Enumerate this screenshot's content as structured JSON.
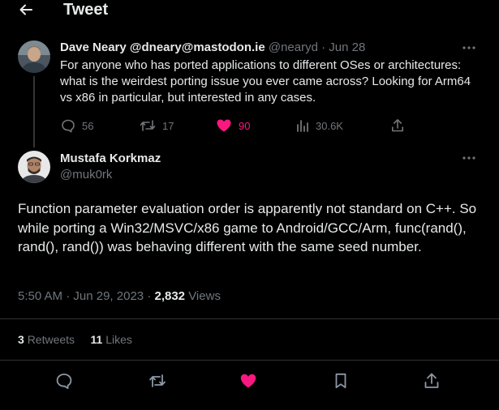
{
  "header": {
    "title": "Tweet",
    "back_icon": "arrow-left-icon"
  },
  "tweet1": {
    "name": "Dave Neary @dneary@mastodon.ie",
    "handle": "@nearyd",
    "sep": "·",
    "date": "Jun 28",
    "text": "For anyone who has ported applications to different OSes or architectures: what is the weirdest porting issue you ever came across? Looking for Arm64 vs x86 in particular, but interested in any cases.",
    "replies": "56",
    "retweets": "17",
    "likes": "90",
    "views": "30.6K"
  },
  "tweet2": {
    "name": "Mustafa Korkmaz",
    "handle": "@muk0rk",
    "text": "Function parameter evaluation order is apparently not standard on C++. So while porting a Win32/MSVC/x86 game to Android/GCC/Arm, func(rand(), rand(), rand()) was behaving different with the same seed number.",
    "time": "5:50 AM",
    "sep": "·",
    "date": "Jun 29, 2023",
    "view_count": "2,832",
    "views_label": "Views",
    "retweet_count": "3",
    "retweets_label": "Retweets",
    "like_count": "11",
    "likes_label": "Likes"
  },
  "colors": {
    "like_pink": "#f91880",
    "muted": "#71767b",
    "text": "#e7e9ea",
    "background": "#000000"
  }
}
